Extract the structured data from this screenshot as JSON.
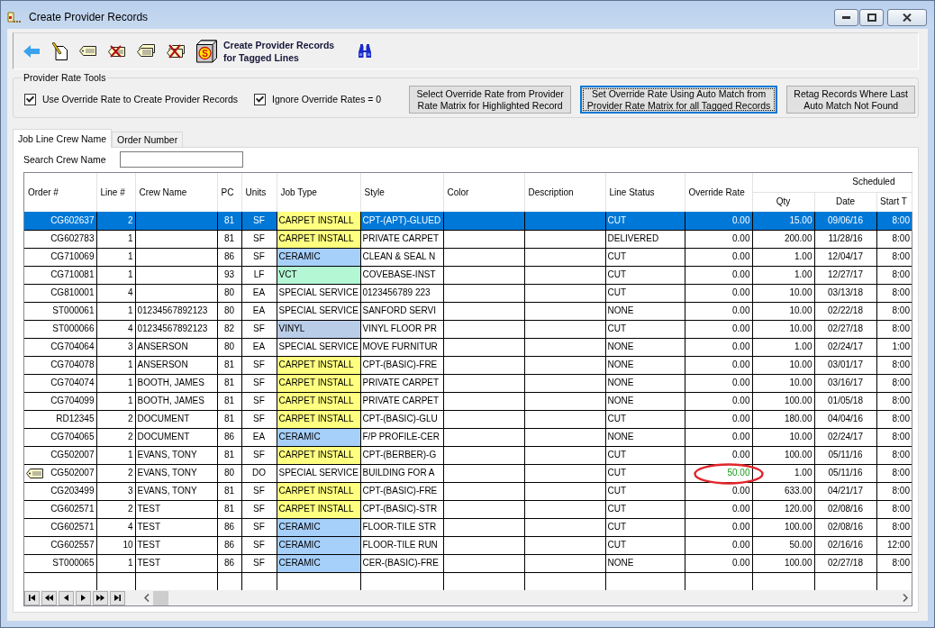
{
  "window": {
    "title": "Create Provider Records"
  },
  "toolbar": {
    "create_button": {
      "icon_letter": "S",
      "label": "Create Provider Records\nfor Tagged Lines"
    }
  },
  "rate_tools": {
    "title": "Provider Rate Tools",
    "options": [
      {
        "label": "Use Override Rate to Create Provider Records",
        "checked": true
      },
      {
        "label": "Ignore Override Rates = 0",
        "checked": true
      }
    ],
    "buttons": [
      {
        "label": "Select Override Rate from Provider\nRate Matrix for Highlighted Record",
        "focused": false
      },
      {
        "label": "Set Override Rate Using Auto Match from\nProvider Rate Matrix for all Tagged Records",
        "focused": true
      },
      {
        "label": "Retag Records Where Last\nAuto Match Not Found",
        "focused": false
      }
    ]
  },
  "tabs": [
    {
      "label": "Job Line Crew Name",
      "selected": true
    },
    {
      "label": "Order Number",
      "selected": false
    }
  ],
  "search": {
    "label": "Search Crew Name"
  },
  "table": {
    "columns": [
      {
        "label": "Order #",
        "kind": "number"
      },
      {
        "label": "Line #",
        "kind": "number"
      },
      {
        "label": "Crew Name",
        "kind": "text"
      },
      {
        "label": "PC",
        "kind": "code"
      },
      {
        "label": "Units",
        "kind": "code"
      },
      {
        "label": "Job Type",
        "kind": "text"
      },
      {
        "label": "Style",
        "kind": "text"
      },
      {
        "label": "Color",
        "kind": "text"
      },
      {
        "label": "Description",
        "kind": "text"
      },
      {
        "label": "Line Status",
        "kind": "text"
      },
      {
        "label": "Override Rate",
        "kind": "number"
      },
      {
        "label": "Scheduled",
        "children": [
          {
            "label": "Qty",
            "kind": "number"
          },
          {
            "label": "Date",
            "kind": "code"
          },
          {
            "label": "Start T",
            "kind": "number"
          }
        ]
      }
    ],
    "rows": [
      {
        "selected": true,
        "tagged": false,
        "override_set": false,
        "circled": false,
        "order": "CG602637",
        "line": "2",
        "pc": "81",
        "units": "SF",
        "job_type": {
          "text": "CARPET INSTALL",
          "color": "#ffff80"
        },
        "style": "CPT-(APT)-GLUED",
        "line_status": "CUT",
        "override_rate": "0.00",
        "qty": "15.00",
        "date": "09/06/16",
        "start_time": "8:00"
      },
      {
        "selected": false,
        "tagged": false,
        "override_set": false,
        "circled": false,
        "order": "CG602783",
        "line": "1",
        "pc": "81",
        "units": "SF",
        "job_type": {
          "text": "CARPET INSTALL",
          "color": "#ffff80"
        },
        "style": "PRIVATE CARPET",
        "line_status": "DELIVERED",
        "override_rate": "0.00",
        "qty": "200.00",
        "date": "11/28/16",
        "start_time": "8:00"
      },
      {
        "selected": false,
        "tagged": false,
        "override_set": false,
        "circled": false,
        "order": "CG710069",
        "line": "1",
        "pc": "86",
        "units": "SF",
        "job_type": {
          "text": "CERAMIC",
          "color": "#a6cffa"
        },
        "style": "CLEAN & SEAL N",
        "line_status": "CUT",
        "override_rate": "0.00",
        "qty": "1.00",
        "date": "12/04/17",
        "start_time": "8:00"
      },
      {
        "selected": false,
        "tagged": false,
        "override_set": false,
        "circled": false,
        "order": "CG710081",
        "line": "1",
        "pc": "93",
        "units": "LF",
        "job_type": {
          "text": "VCT",
          "color": "#b4f7d4"
        },
        "style": "COVEBASE-INST",
        "line_status": "CUT",
        "override_rate": "0.00",
        "qty": "1.00",
        "date": "12/27/17",
        "start_time": "8:00"
      },
      {
        "selected": false,
        "tagged": false,
        "override_set": false,
        "circled": false,
        "order": "CG810001",
        "line": "4",
        "pc": "80",
        "units": "EA",
        "job_type": {
          "text": "SPECIAL SERVICE"
        },
        "style": "0123456789 223",
        "line_status": "CUT",
        "override_rate": "0.00",
        "qty": "10.00",
        "date": "03/13/18",
        "start_time": "8:00"
      },
      {
        "selected": false,
        "tagged": false,
        "override_set": false,
        "circled": false,
        "order": "ST000061",
        "line": "1",
        "crew_name": "01234567892123",
        "pc": "80",
        "units": "EA",
        "job_type": {
          "text": "SPECIAL SERVICE"
        },
        "style": "SANFORD SERVI",
        "line_status": "NONE",
        "override_rate": "0.00",
        "qty": "10.00",
        "date": "02/22/18",
        "start_time": "8:00"
      },
      {
        "selected": false,
        "tagged": false,
        "override_set": false,
        "circled": false,
        "order": "ST000066",
        "line": "4",
        "crew_name": "01234567892123",
        "pc": "82",
        "units": "SF",
        "job_type": {
          "text": "VINYL",
          "color": "#bacde8"
        },
        "style": "VINYL FLOOR PR",
        "line_status": "CUT",
        "override_rate": "0.00",
        "qty": "10.00",
        "date": "02/27/18",
        "start_time": "8:00"
      },
      {
        "selected": false,
        "tagged": false,
        "override_set": false,
        "circled": false,
        "order": "CG704064",
        "line": "3",
        "crew_name": "ANSERSON",
        "pc": "80",
        "units": "EA",
        "job_type": {
          "text": "SPECIAL SERVICE"
        },
        "style": "MOVE FURNITUR",
        "line_status": "NONE",
        "override_rate": "0.00",
        "qty": "1.00",
        "date": "02/24/17",
        "start_time": "1:00"
      },
      {
        "selected": false,
        "tagged": false,
        "override_set": false,
        "circled": false,
        "order": "CG704078",
        "line": "1",
        "crew_name": "ANSERSON",
        "pc": "81",
        "units": "SF",
        "job_type": {
          "text": "CARPET INSTALL",
          "color": "#ffff80"
        },
        "style": "CPT-(BASIC)-FRE",
        "line_status": "NONE",
        "override_rate": "0.00",
        "qty": "10.00",
        "date": "03/01/17",
        "start_time": "8:00"
      },
      {
        "selected": false,
        "tagged": false,
        "override_set": false,
        "circled": false,
        "order": "CG704074",
        "line": "1",
        "crew_name": "BOOTH, JAMES",
        "pc": "81",
        "units": "SF",
        "job_type": {
          "text": "CARPET INSTALL",
          "color": "#ffff80"
        },
        "style": "PRIVATE CARPET",
        "line_status": "NONE",
        "override_rate": "0.00",
        "qty": "10.00",
        "date": "03/16/17",
        "start_time": "8:00"
      },
      {
        "selected": false,
        "tagged": false,
        "override_set": false,
        "circled": false,
        "order": "CG704099",
        "line": "1",
        "crew_name": "BOOTH, JAMES",
        "pc": "81",
        "units": "SF",
        "job_type": {
          "text": "CARPET INSTALL",
          "color": "#ffff80"
        },
        "style": "PRIVATE CARPET",
        "line_status": "NONE",
        "override_rate": "0.00",
        "qty": "100.00",
        "date": "01/05/18",
        "start_time": "8:00"
      },
      {
        "selected": false,
        "tagged": false,
        "override_set": false,
        "circled": false,
        "order": "RD12345",
        "line": "2",
        "crew_name": "DOCUMENT",
        "pc": "81",
        "units": "SF",
        "job_type": {
          "text": "CARPET INSTALL",
          "color": "#ffff80"
        },
        "style": "CPT-(BASIC)-GLU",
        "line_status": "CUT",
        "override_rate": "0.00",
        "qty": "180.00",
        "date": "04/04/16",
        "start_time": "8:00"
      },
      {
        "selected": false,
        "tagged": false,
        "override_set": false,
        "circled": false,
        "order": "CG704065",
        "line": "2",
        "crew_name": "DOCUMENT",
        "pc": "86",
        "units": "EA",
        "job_type": {
          "text": "CERAMIC",
          "color": "#a6cffa"
        },
        "style": "F/P PROFILE-CER",
        "line_status": "NONE",
        "override_rate": "0.00",
        "qty": "10.00",
        "date": "02/24/17",
        "start_time": "8:00"
      },
      {
        "selected": false,
        "tagged": false,
        "override_set": false,
        "circled": false,
        "order": "CG502007",
        "line": "1",
        "crew_name": "EVANS, TONY",
        "pc": "81",
        "units": "SF",
        "job_type": {
          "text": "CARPET INSTALL",
          "color": "#ffff80"
        },
        "style": "CPT-(BERBER)-G",
        "line_status": "CUT",
        "override_rate": "0.00",
        "qty": "100.00",
        "date": "05/11/16",
        "start_time": "8:00"
      },
      {
        "selected": false,
        "tagged": true,
        "override_set": true,
        "circled": true,
        "order": "CG502007",
        "line": "2",
        "crew_name": "EVANS, TONY",
        "pc": "80",
        "units": "DO",
        "job_type": {
          "text": "SPECIAL SERVICE"
        },
        "style": "BUILDING FOR A",
        "line_status": "CUT",
        "override_rate": "50.00",
        "qty": "1.00",
        "date": "05/11/16",
        "start_time": "8:00"
      },
      {
        "selected": false,
        "tagged": false,
        "override_set": false,
        "circled": false,
        "order": "CG203499",
        "line": "3",
        "crew_name": "EVANS, TONY",
        "pc": "81",
        "units": "SF",
        "job_type": {
          "text": "CARPET INSTALL",
          "color": "#ffff80"
        },
        "style": "CPT-(BASIC)-FRE",
        "line_status": "CUT",
        "override_rate": "0.00",
        "qty": "633.00",
        "date": "04/21/17",
        "start_time": "8:00"
      },
      {
        "selected": false,
        "tagged": false,
        "override_set": false,
        "circled": false,
        "order": "CG602571",
        "line": "2",
        "crew_name": "TEST",
        "pc": "81",
        "units": "SF",
        "job_type": {
          "text": "CARPET INSTALL",
          "color": "#ffff80"
        },
        "style": "CPT-(BASIC)-STR",
        "line_status": "CUT",
        "override_rate": "0.00",
        "qty": "120.00",
        "date": "02/08/16",
        "start_time": "8:00"
      },
      {
        "selected": false,
        "tagged": false,
        "override_set": false,
        "circled": false,
        "order": "CG602571",
        "line": "4",
        "crew_name": "TEST",
        "pc": "86",
        "units": "SF",
        "job_type": {
          "text": "CERAMIC",
          "color": "#a6cffa"
        },
        "style": "FLOOR-TILE STR",
        "line_status": "CUT",
        "override_rate": "0.00",
        "qty": "100.00",
        "date": "02/08/16",
        "start_time": "8:00"
      },
      {
        "selected": false,
        "tagged": false,
        "override_set": false,
        "circled": false,
        "order": "CG602557",
        "line": "10",
        "crew_name": "TEST",
        "pc": "86",
        "units": "SF",
        "job_type": {
          "text": "CERAMIC",
          "color": "#a6cffa"
        },
        "style": "FLOOR-TILE RUN",
        "line_status": "CUT",
        "override_rate": "0.00",
        "qty": "50.00",
        "date": "02/16/16",
        "start_time": "12:00"
      },
      {
        "selected": false,
        "tagged": false,
        "override_set": false,
        "circled": false,
        "order": "ST000065",
        "line": "1",
        "crew_name": "TEST",
        "pc": "86",
        "units": "SF",
        "job_type": {
          "text": "CERAMIC",
          "color": "#a6cffa"
        },
        "style": "CER-(BASIC)-FRE",
        "line_status": "NONE",
        "override_rate": "0.00",
        "qty": "100.00",
        "date": "02/27/18",
        "start_time": "8:00"
      }
    ]
  }
}
